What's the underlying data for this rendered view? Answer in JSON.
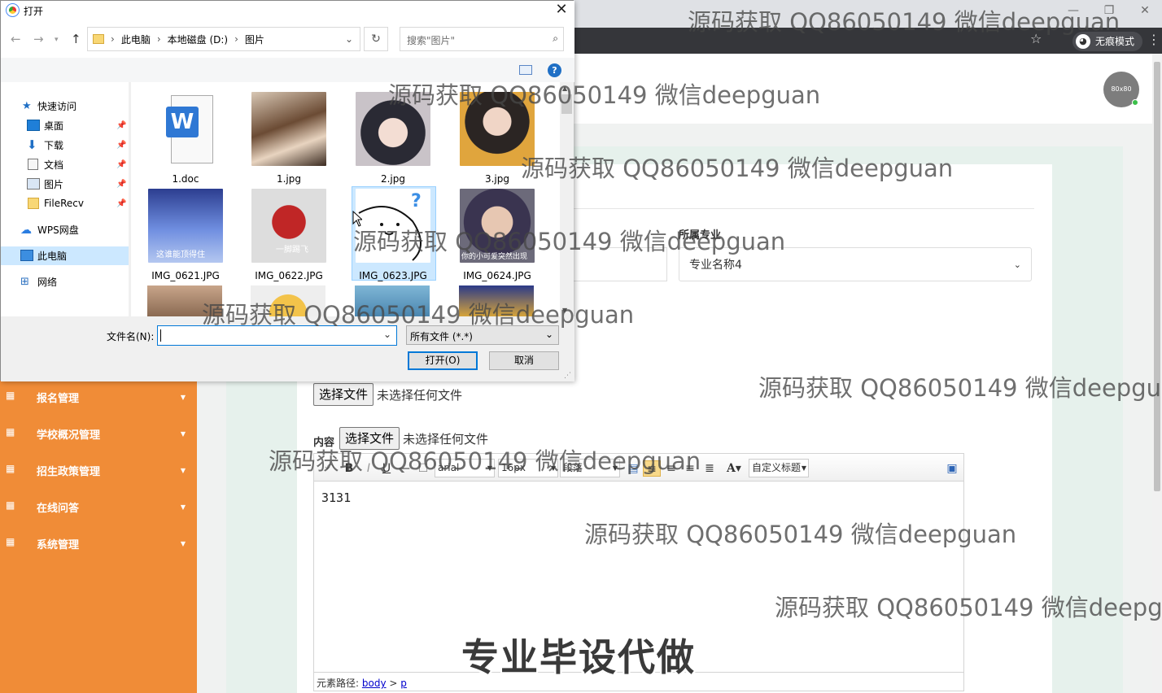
{
  "browser": {
    "incognito_label": "无痕模式"
  },
  "dialog": {
    "title": "打开",
    "breadcrumb": [
      "此电脑",
      "本地磁盘 (D:)",
      "图片"
    ],
    "search_placeholder": "搜索\"图片\"",
    "nav_items": [
      {
        "label": "快速访问",
        "icon": "star-icon"
      },
      {
        "label": "桌面",
        "icon": "desktop-icon",
        "pinned": true
      },
      {
        "label": "下载",
        "icon": "download-icon",
        "pinned": true
      },
      {
        "label": "文档",
        "icon": "document-icon",
        "pinned": true
      },
      {
        "label": "图片",
        "icon": "picture-icon",
        "pinned": true
      },
      {
        "label": "FileRecv",
        "icon": "folder-icon",
        "pinned": true
      },
      {
        "label": "WPS网盘",
        "icon": "cloud-icon"
      },
      {
        "label": "此电脑",
        "icon": "computer-icon",
        "selected": true
      },
      {
        "label": "网络",
        "icon": "network-icon"
      }
    ],
    "files": [
      {
        "name": "1.doc",
        "kind": "word-doc-icon"
      },
      {
        "name": "1.jpg",
        "kind": "photo"
      },
      {
        "name": "2.jpg",
        "kind": "photo"
      },
      {
        "name": "3.jpg",
        "kind": "photo"
      },
      {
        "name": "IMG_0621.JPG",
        "kind": "photo",
        "caption": "这谁能顶得住"
      },
      {
        "name": "IMG_0622.JPG",
        "kind": "photo",
        "caption": "一脚踢飞"
      },
      {
        "name": "IMG_0623.JPG",
        "kind": "photo",
        "selected": true
      },
      {
        "name": "IMG_0624.JPG",
        "kind": "photo",
        "caption": "你的小可爱突然出现"
      }
    ],
    "filename_label": "文件名(N):",
    "filename_value": "",
    "filetype_value": "所有文件 (*.*)",
    "open_button": "打开(O)",
    "cancel_button": "取消"
  },
  "sidebar": {
    "items": [
      {
        "label": "报名管理"
      },
      {
        "label": "学校概况管理"
      },
      {
        "label": "招生政策管理"
      },
      {
        "label": "在线问答"
      },
      {
        "label": "系统管理"
      }
    ]
  },
  "header": {
    "avatar_text": "80x80"
  },
  "form": {
    "major_label": "所属专业",
    "major_value": "专业名称4",
    "file_button": "选择文件",
    "no_file_text": "未选择任何文件",
    "content_label": "内容",
    "content_file_button": "选择文件",
    "content_no_file_text": "未选择任何文件"
  },
  "editor": {
    "font_family": "arial",
    "font_size": "16px",
    "paragraph": "段落",
    "custom_title": "自定义标题",
    "body_text": "3131",
    "status_prefix": "元素路径:",
    "status_path": [
      "body",
      "p"
    ]
  },
  "overlay": {
    "watermark": "源码获取 QQ86050149 微信deepguan",
    "watermark_clip1": "源码获取 QQ86050149 微信deepgu",
    "watermark_clip2": "源码获取 QQ86050149 微信deepg",
    "big_text": "专业毕设代做"
  },
  "colors": {
    "sidebar": "#f08c37",
    "accent": "#0078d7"
  }
}
